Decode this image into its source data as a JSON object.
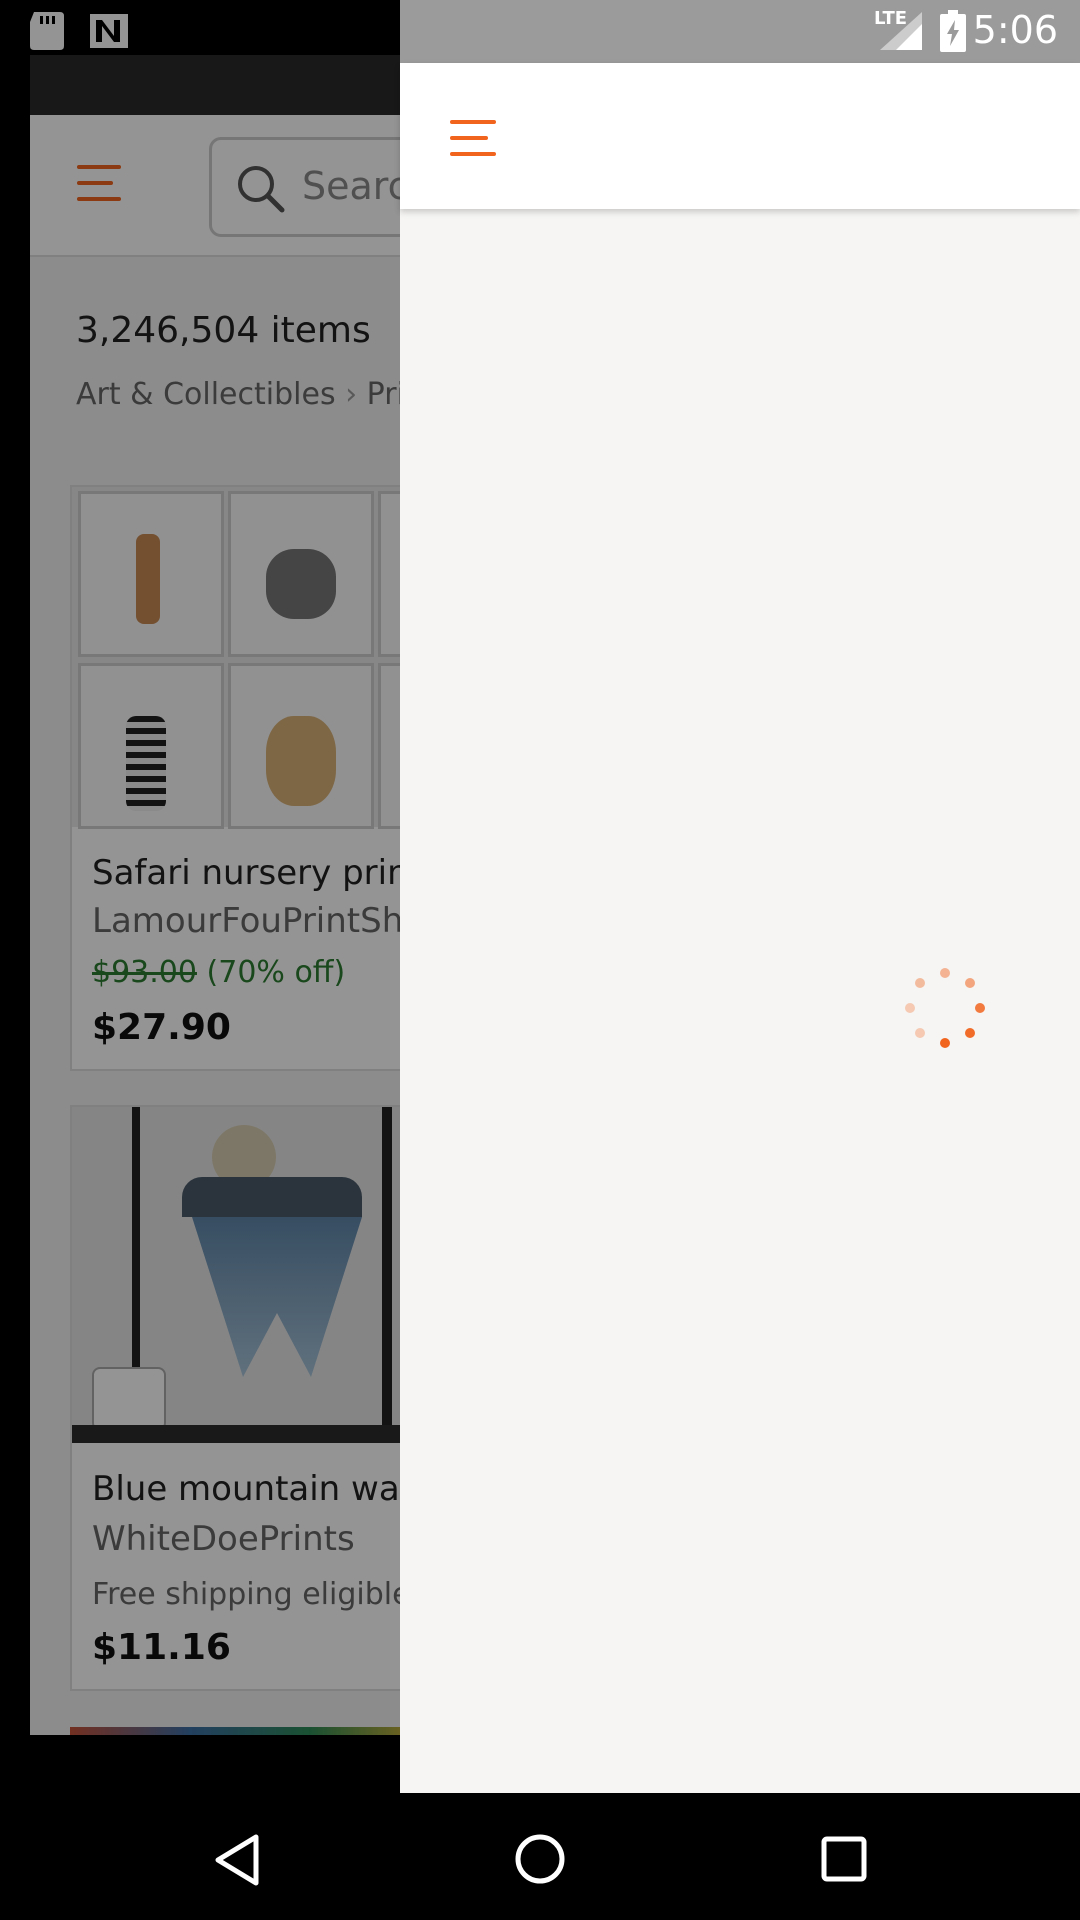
{
  "status_bar": {
    "time": "5:06",
    "network": "LTE",
    "icons": [
      "sd-card-icon",
      "notification-n-icon",
      "lte-signal-icon",
      "battery-charging-icon"
    ]
  },
  "background_screen": {
    "search_placeholder": "Search",
    "item_count": "3,246,504 items",
    "breadcrumb": [
      "Art & Collectibles",
      "Pri"
    ],
    "listings": [
      {
        "title": "Safari nursery print",
        "shop": "LamourFouPrintShe",
        "original_price": "$93.00",
        "discount": "(70% off)",
        "price": "$27.90"
      },
      {
        "title": "Blue mountain wall",
        "shop": "WhiteDoePrints",
        "shipping": "Free shipping eligible",
        "price": "$11.16"
      }
    ]
  },
  "drawer": {
    "menu_icon": "hamburger-menu-icon",
    "state": "loading",
    "accent_color": "#f1641e"
  },
  "nav_bar": {
    "buttons": [
      "back",
      "home",
      "recents"
    ]
  }
}
